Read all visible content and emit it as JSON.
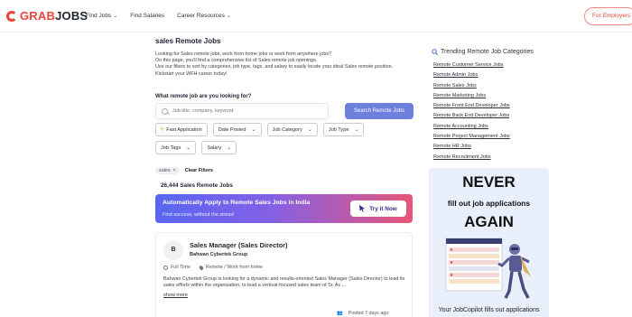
{
  "header": {
    "logo_part1": "GRAB",
    "logo_part2": "JOBS",
    "nav": [
      {
        "label": "Find Jobs",
        "chevron": "⌄"
      },
      {
        "label": "Find Salaries",
        "chevron": ""
      },
      {
        "label": "Career Resources",
        "chevron": "⌄"
      }
    ],
    "employers_button": "For Employers"
  },
  "main": {
    "title": "sales Remote Jobs",
    "intro_lines": [
      "Looking for Sales remote jobs, work from home jobs or work from anywhere jobs?",
      "On this page, you'll find a comprehensive list of Sales remote job openings.",
      "Use our filters to sort by categories, job type, tags, and salary to easily locate your ideal Sales remote position.",
      "Kickstart your WFH career today!"
    ],
    "search_label": "What remote job are you looking for?",
    "search_placeholder": "Job title, company, keyword",
    "search_button": "Search Remote Jobs",
    "filters": [
      {
        "label": "Fast Application",
        "icon": "bolt-icon",
        "chevron": ""
      },
      {
        "label": "Date Posted",
        "chevron": "⌄"
      },
      {
        "label": "Job Category",
        "chevron": "⌄"
      },
      {
        "label": "Job Type",
        "chevron": "⌄"
      },
      {
        "label": "Job Tags",
        "chevron": "⌄"
      },
      {
        "label": "Salary",
        "chevron": "⌄"
      }
    ],
    "active_tag": "sales",
    "active_tag_remove": "×",
    "clear_filters": "Clear Filters",
    "results_count": "26,444 Sales Remote Jobs",
    "banner": {
      "title": "Automatically Apply to Remote Sales Jobs in India",
      "subtitle": "Find success, without the stress!",
      "button": "Try it Now"
    },
    "job": {
      "logo_letter": "B",
      "title": "Sales Manager (Sales Director)",
      "company": "Bahwan Cybertek Group",
      "job_type": "Full Time",
      "location": "Remote / Work from home",
      "description": "Bahwan Cybertek Group is looking for a dynamic and results-oriented Sales Manager (Sales Director) to lead its sales efforts within the organization, to lead a vertical-focused sales team of Sr. Ac ...",
      "show_more": "show more",
      "posted": "Posted 7 days ago"
    }
  },
  "sidebar": {
    "title": "Trending Remote Job Categories",
    "categories": [
      "Remote Customer Service Jobs",
      "Remote Admin Jobs",
      "Remote Sales Jobs",
      "Remote Marketing Jobs",
      "Remote Front End Developer Jobs",
      "Remote Back End Developer Jobs",
      "Remote Accounting Jobs",
      "Remote Project Management Jobs",
      "Remote HR Jobs",
      "Remote Recruitment Jobs"
    ],
    "promo": {
      "line1": "NEVER",
      "line2": "fill out job applications",
      "line3": "AGAIN",
      "footer": "Your JobCopilot fills out applications"
    }
  },
  "colors": {
    "brand": "#e8463a",
    "search_button": "#6f7fde",
    "banner_start": "#5867f2",
    "banner_end": "#e6557a",
    "promo_bg": "#e9f0fb"
  }
}
